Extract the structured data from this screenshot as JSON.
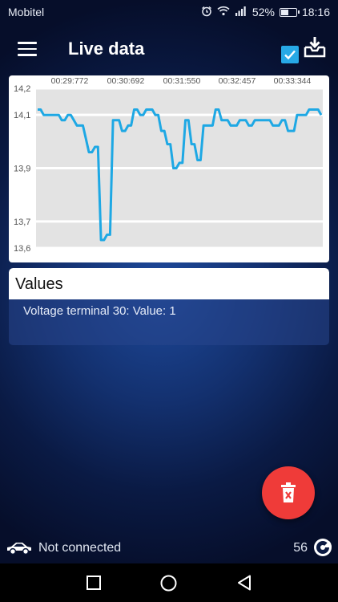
{
  "status_bar": {
    "carrier": "Mobitel",
    "battery_percent": "52%",
    "battery_level": 0.52,
    "time": "18:16",
    "icons": [
      "alarm-icon",
      "wifi-icon",
      "signal-icon",
      "battery-icon"
    ]
  },
  "app_bar": {
    "title": "Live data",
    "menu_icon": "hamburger-menu-icon",
    "action_icon": "download-tray-icon"
  },
  "chart_data": {
    "type": "line",
    "x_tick_labels": [
      "00:29:772",
      "00:30:692",
      "00:31:550",
      "00:32:457",
      "00:33:344"
    ],
    "y_ticks": [
      "14,2",
      "14,1",
      "13,9",
      "13,7",
      "13,6"
    ],
    "ylim": [
      13.6,
      14.2
    ],
    "grid": true,
    "line_color": "#1ea8e4",
    "series": [
      {
        "values": [
          14.12,
          14.12,
          14.1,
          14.1,
          14.1,
          14.1,
          14.1,
          14.1,
          14.08,
          14.08,
          14.1,
          14.1,
          14.08,
          14.06,
          14.06,
          14.06,
          14.01,
          13.96,
          13.96,
          13.98,
          13.98,
          13.63,
          13.63,
          13.65,
          13.65,
          14.08,
          14.08,
          14.08,
          14.04,
          14.04,
          14.06,
          14.06,
          14.12,
          14.12,
          14.1,
          14.1,
          14.12,
          14.12,
          14.12,
          14.1,
          14.1,
          14.04,
          14.04,
          13.99,
          13.99,
          13.9,
          13.9,
          13.92,
          13.92,
          14.08,
          14.08,
          13.99,
          13.99,
          13.93,
          13.93,
          14.06,
          14.06,
          14.06,
          14.06,
          14.12,
          14.12,
          14.08,
          14.08,
          14.08,
          14.06,
          14.06,
          14.06,
          14.08,
          14.08,
          14.08,
          14.06,
          14.06,
          14.08,
          14.08,
          14.08,
          14.08,
          14.08,
          14.08,
          14.06,
          14.06,
          14.06,
          14.08,
          14.08,
          14.04,
          14.04,
          14.04,
          14.1,
          14.1,
          14.1,
          14.1,
          14.12,
          14.12,
          14.12,
          14.12,
          14.1
        ]
      }
    ]
  },
  "values_panel": {
    "header": "Values",
    "rows": [
      {
        "label": "Voltage terminal 30: Value: 1",
        "checked": true
      }
    ]
  },
  "fab": {
    "icon": "delete-icon"
  },
  "connection": {
    "status": "Not connected",
    "count": "56",
    "car_icon": "car-icon",
    "count_icon": "dial-icon"
  },
  "nav": {
    "items": [
      "recent-apps-button",
      "home-button",
      "back-button"
    ]
  }
}
